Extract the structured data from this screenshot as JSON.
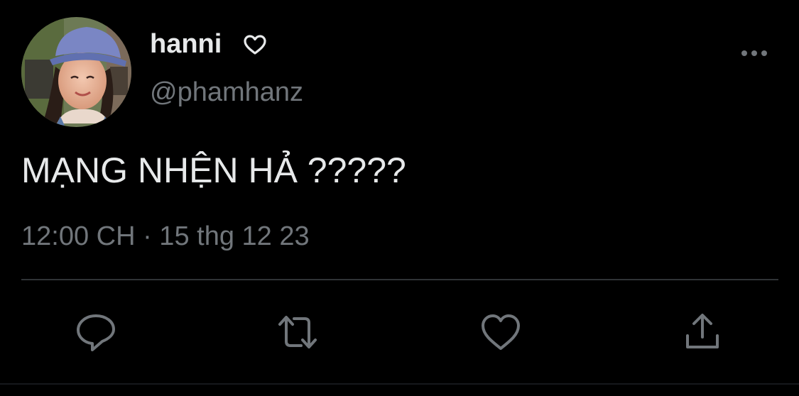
{
  "tweet": {
    "display_name": "hanni",
    "handle": "@phamhanz",
    "text": "MẠNG NHỆN HẢ ?????",
    "timestamp": "12:00 CH · 15 thg 12 23"
  },
  "icons": {
    "name_badge": "heart-outline-icon",
    "more": "more-horizontal-icon",
    "actions": [
      "reply-icon",
      "retweet-icon",
      "like-icon",
      "share-icon"
    ]
  },
  "colors": {
    "background": "#000000",
    "primary_text": "#e7e9ea",
    "secondary_text": "#71767b",
    "divider": "#2f3336"
  }
}
